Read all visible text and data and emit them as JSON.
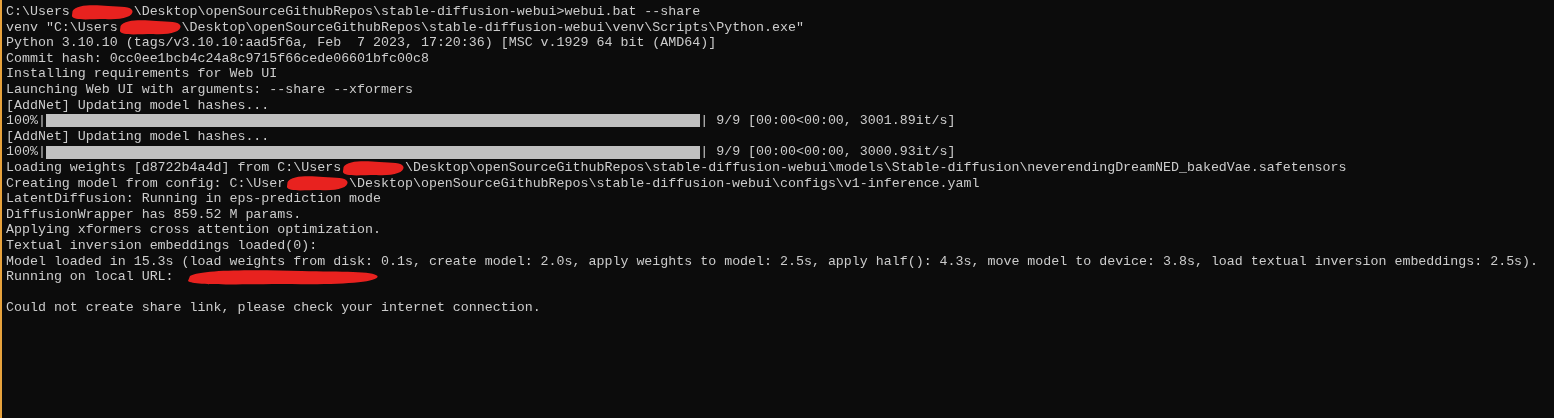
{
  "console": {
    "lines": [
      {
        "kind": "text",
        "segments": [
          {
            "kind": "text",
            "text": "C:\\Users"
          },
          {
            "kind": "redaction"
          },
          {
            "kind": "text",
            "text": "\\Desktop\\openSourceGithubRepos\\stable-diffusion-webui>webui.bat --share"
          }
        ]
      },
      {
        "kind": "text",
        "segments": [
          {
            "kind": "text",
            "text": "venv \"C:\\Users"
          },
          {
            "kind": "redaction"
          },
          {
            "kind": "text",
            "text": "\\Desktop\\openSourceGithubRepos\\stable-diffusion-webui\\venv\\Scripts\\Python.exe\""
          }
        ]
      },
      {
        "kind": "text",
        "segments": [
          {
            "kind": "text",
            "text": "Python 3.10.10 (tags/v3.10.10:aad5f6a, Feb  7 2023, 17:20:36) [MSC v.1929 64 bit (AMD64)]"
          }
        ]
      },
      {
        "kind": "text",
        "segments": [
          {
            "kind": "text",
            "text": "Commit hash: 0cc0ee1bcb4c24a8c9715f66cede06601bfc00c8"
          }
        ]
      },
      {
        "kind": "text",
        "segments": [
          {
            "kind": "text",
            "text": "Installing requirements for Web UI"
          }
        ]
      },
      {
        "kind": "text",
        "segments": [
          {
            "kind": "text",
            "text": "Launching Web UI with arguments: --share --xformers"
          }
        ]
      },
      {
        "kind": "text",
        "segments": [
          {
            "kind": "text",
            "text": "[AddNet] Updating model hashes..."
          }
        ]
      },
      {
        "kind": "progress",
        "prefix": "100%|",
        "level": 1,
        "suffix": "| 9/9 [00:00<00:00, 3001.89it/s]"
      },
      {
        "kind": "text",
        "segments": [
          {
            "kind": "text",
            "text": "[AddNet] Updating model hashes..."
          }
        ]
      },
      {
        "kind": "progress",
        "prefix": "100%|",
        "level": 1,
        "suffix": "| 9/9 [00:00<00:00, 3000.93it/s]"
      },
      {
        "kind": "text",
        "segments": [
          {
            "kind": "text",
            "text": "Loading weights [d8722b4a4d] from C:\\Users"
          },
          {
            "kind": "redaction"
          },
          {
            "kind": "text",
            "text": "\\Desktop\\openSourceGithubRepos\\stable-diffusion-webui\\models\\Stable-diffusion\\neverendingDreamNED_bakedVae.safetensors"
          }
        ]
      },
      {
        "kind": "text",
        "segments": [
          {
            "kind": "text",
            "text": "Creating model from config: C:\\User"
          },
          {
            "kind": "redaction"
          },
          {
            "kind": "text",
            "text": "\\Desktop\\openSourceGithubRepos\\stable-diffusion-webui\\configs\\v1-inference.yaml"
          }
        ]
      },
      {
        "kind": "text",
        "segments": [
          {
            "kind": "text",
            "text": "LatentDiffusion: Running in eps-prediction mode"
          }
        ]
      },
      {
        "kind": "text",
        "segments": [
          {
            "kind": "text",
            "text": "DiffusionWrapper has 859.52 M params."
          }
        ]
      },
      {
        "kind": "text",
        "segments": [
          {
            "kind": "text",
            "text": "Applying xformers cross attention optimization."
          }
        ]
      },
      {
        "kind": "text",
        "segments": [
          {
            "kind": "text",
            "text": "Textual inversion embeddings loaded(0):"
          }
        ]
      },
      {
        "kind": "text",
        "segments": [
          {
            "kind": "text",
            "text": "Model loaded in 15.3s (load weights from disk: 0.1s, create model: 2.0s, apply weights to model: 2.5s, apply half(): 4.3s, move model to device: 3.8s, load textual inversion embeddings: 2.5s)."
          }
        ]
      },
      {
        "kind": "text",
        "segments": [
          {
            "kind": "text",
            "text": "Running on local URL: "
          },
          {
            "kind": "redaction-long"
          }
        ]
      },
      {
        "kind": "blank"
      },
      {
        "kind": "text",
        "segments": [
          {
            "kind": "text",
            "text": "Could not create share link, please check your internet connection."
          }
        ]
      }
    ]
  }
}
